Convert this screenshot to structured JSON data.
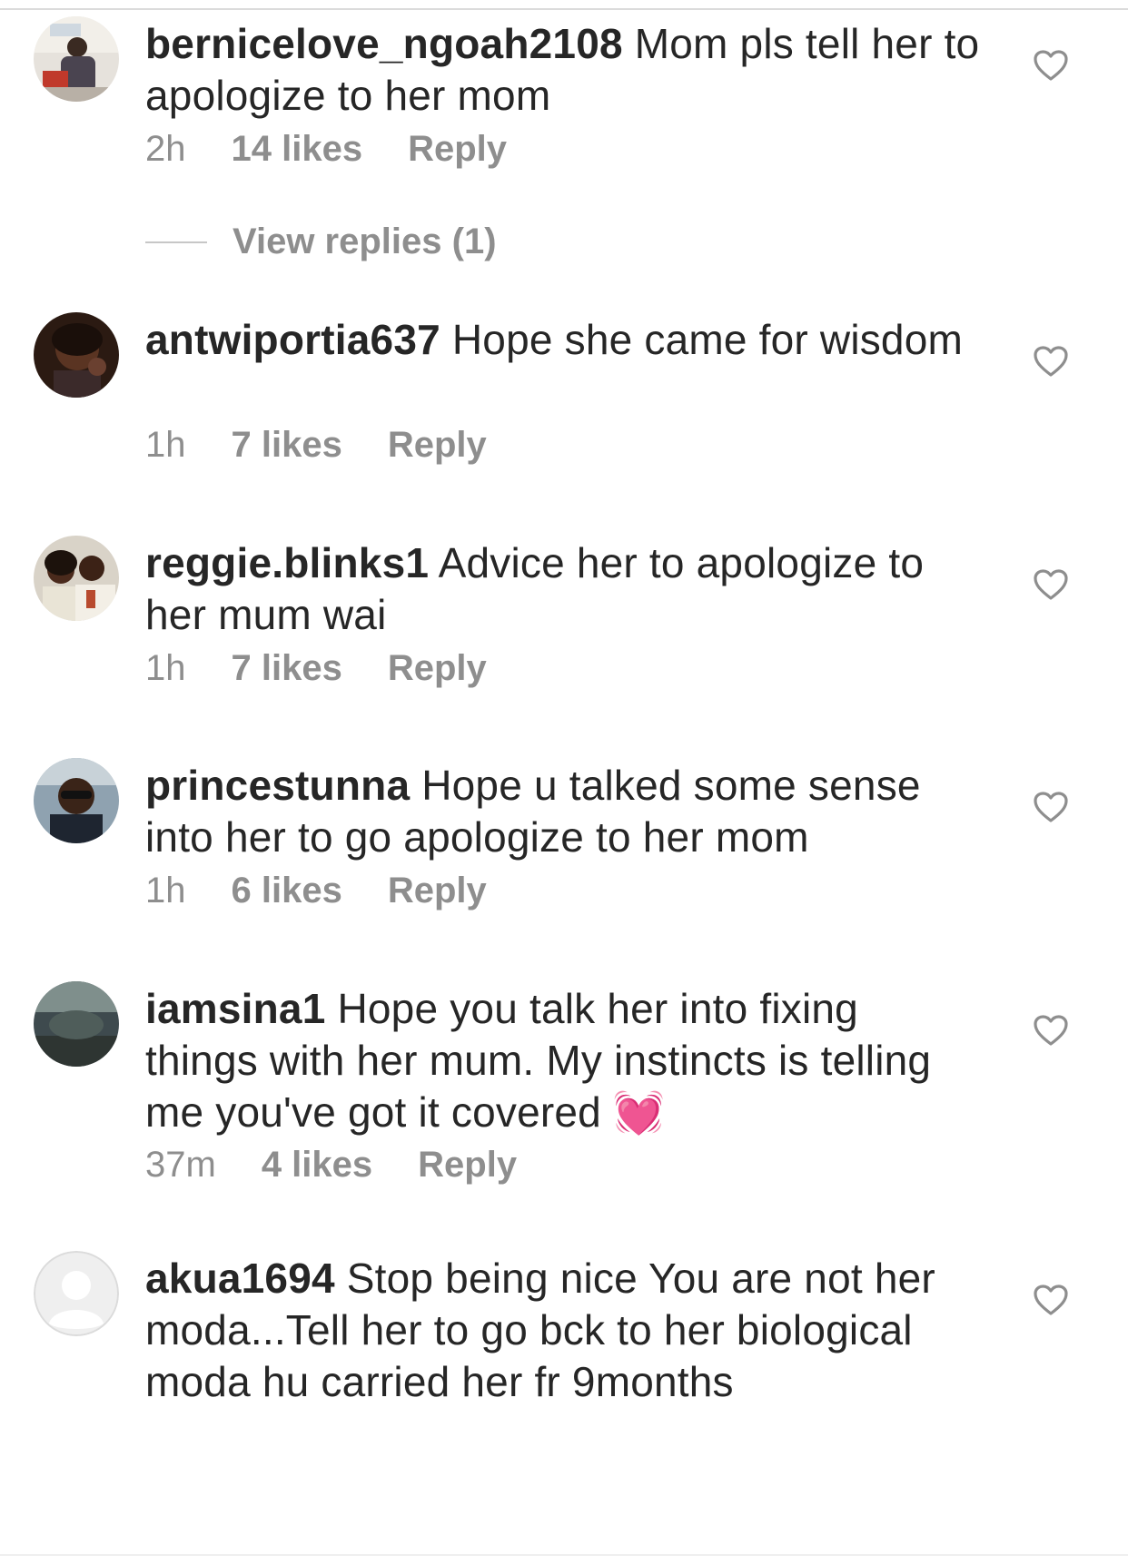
{
  "comments": [
    {
      "username": "bernicelove_ngoah2108",
      "text": "Mom pls tell her to apologize to her mom",
      "time": "2h",
      "likes": "14 likes",
      "reply": "Reply",
      "view_replies": "View replies (1)"
    },
    {
      "username": "antwiportia637",
      "text": "Hope she came for wisdom",
      "time": "1h",
      "likes": "7 likes",
      "reply": "Reply"
    },
    {
      "username": "reggie.blinks1",
      "text": "Advice her to apologize to her mum wai",
      "time": "1h",
      "likes": "7 likes",
      "reply": "Reply"
    },
    {
      "username": "princestunna",
      "text": "Hope u talked some sense into her to go apologize to her mom",
      "time": "1h",
      "likes": "6 likes",
      "reply": "Reply"
    },
    {
      "username": "iamsina1",
      "text": "Hope you talk her into fixing things with her mum. My instincts is telling me you've got it covered 💓",
      "time": "37m",
      "likes": "4 likes",
      "reply": "Reply"
    },
    {
      "username": "akua1694",
      "text": "Stop being nice You are not her moda...Tell her to go bck to her biological moda hu carried her fr 9months",
      "time": "",
      "likes": "",
      "reply": ""
    }
  ],
  "colors": {
    "text": "#262626",
    "meta": "#8e8e8e",
    "divider": "#dbdbdb"
  },
  "icons": {
    "like": "heart-outline-icon",
    "avatar_placeholder": "default-avatar-icon"
  }
}
